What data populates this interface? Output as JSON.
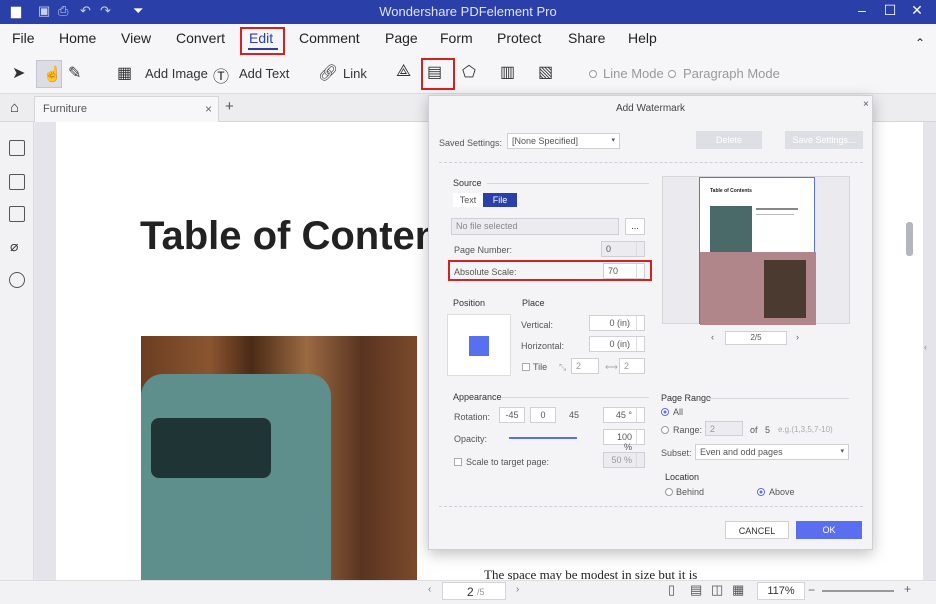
{
  "app": {
    "title": "Wondershare PDFelement Pro"
  },
  "menu": {
    "items": [
      "File",
      "Home",
      "View",
      "Convert",
      "Edit",
      "Comment",
      "Page",
      "Form",
      "Protect",
      "Share",
      "Help"
    ],
    "active": "Edit"
  },
  "toolbar": {
    "add_image": "Add Image",
    "add_text": "Add Text",
    "link": "Link",
    "line_mode": "Line Mode",
    "paragraph_mode": "Paragraph Mode"
  },
  "tab": {
    "name": "Furniture",
    "close": "×",
    "add": "+"
  },
  "document": {
    "heading": "Table of Conten",
    "body_text": "The space may be modest in size but it is"
  },
  "status": {
    "page_current": "2",
    "page_total": "/5",
    "zoom": "117%"
  },
  "dialog": {
    "title": "Add Watermark",
    "saved_settings_label": "Saved Settings:",
    "saved_settings_value": "[None Specified]",
    "delete_label": "Delete",
    "save_settings_label": "Save Settings...",
    "source_label": "Source",
    "text_tab": "Text",
    "file_tab": "File",
    "file_placeholder": "No file selected",
    "browse_label": "...",
    "page_number_label": "Page Number:",
    "page_number_value": "0",
    "absolute_scale_label": "Absolute Scale:",
    "absolute_scale_value": "70",
    "position_label": "Position",
    "place_label": "Place",
    "vertical_label": "Vertical:",
    "vertical_value": "0 (in)",
    "horizontal_label": "Horizontal:",
    "horizontal_value": "0 (in)",
    "tile_label": "Tile",
    "tile_x": "2",
    "tile_y": "2",
    "appearance_label": "Appearance",
    "rotation_label": "Rotation:",
    "rotation_options": [
      "-45",
      "0",
      "45"
    ],
    "rotation_value": "45 °",
    "opacity_label": "Opacity:",
    "opacity_value": "100 %",
    "scale_label": "Scale to target page:",
    "scale_value": "50 %",
    "page_range_label": "Page Range",
    "all_label": "All",
    "range_label": "Range:",
    "range_value": "2",
    "of_label": "of",
    "of_value": "5",
    "range_hint": "e.g.(1,3,5,7-10)",
    "subset_label": "Subset:",
    "subset_value": "Even and odd pages",
    "location_label": "Location",
    "behind_label": "Behind",
    "above_label": "Above",
    "preview_page": "2/5",
    "preview_title": "Table of Contents",
    "cancel_label": "CANCEL",
    "ok_label": "OK"
  },
  "colors": {
    "titlebar": "#2a3fa8",
    "accent": "#5a6ef0",
    "highlight": "#d42121"
  }
}
